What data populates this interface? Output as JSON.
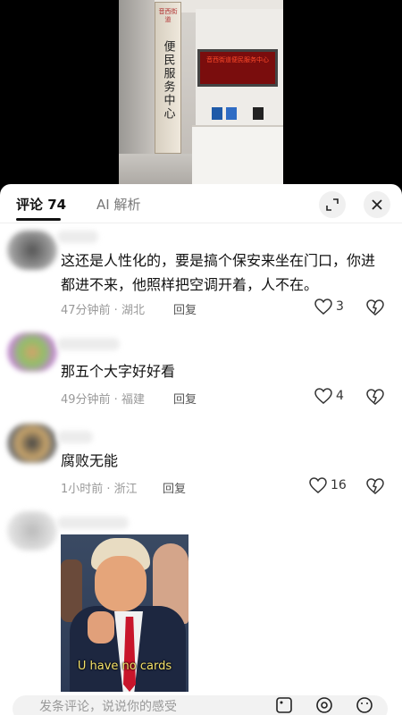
{
  "video": {
    "plaque_small": "音西街道",
    "plaque_main": "便民服务中心",
    "led_text": "音西街道便民服务中心"
  },
  "tabs": {
    "comments_label": "评论 74",
    "ai_label": "AI 解析"
  },
  "comments": [
    {
      "text": "这还是人性化的，要是搞个保安来坐在门口，你进都进不来，他照样把空调开着，人不在。",
      "meta": "47分钟前 · 湖北",
      "reply": "回复",
      "likes": "3"
    },
    {
      "text": "那五个大字好好看",
      "meta": "49分钟前 · 福建",
      "reply": "回复",
      "likes": "4"
    },
    {
      "text": "腐败无能",
      "meta": "1小时前 · 浙江",
      "reply": "回复",
      "likes": "16"
    },
    {
      "sticker_caption": "U have no cards"
    }
  ],
  "input": {
    "placeholder": "发条评论，说说你的感受"
  }
}
